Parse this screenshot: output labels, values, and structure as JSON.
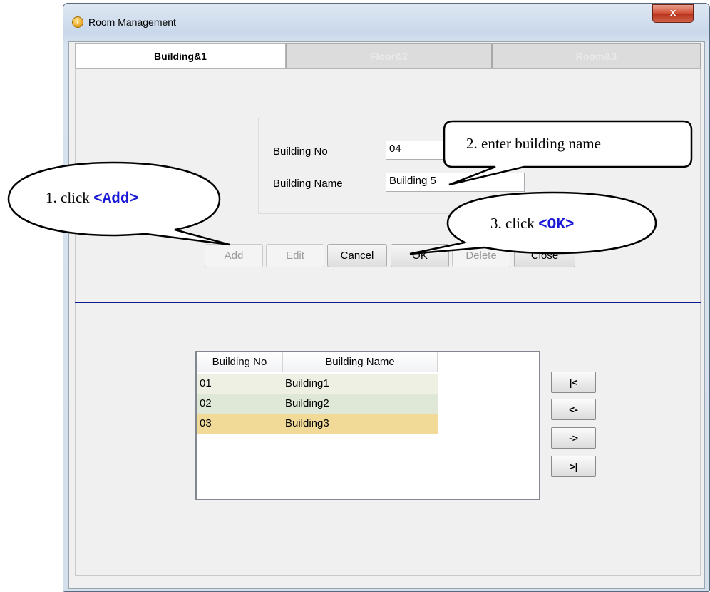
{
  "window": {
    "title": "Room Management",
    "close_glyph": "x",
    "icon": "info-icon"
  },
  "tabs": [
    {
      "label": "Building&1",
      "active": true
    },
    {
      "label": "Floor&2",
      "active": false
    },
    {
      "label": "Room&3",
      "active": false
    }
  ],
  "form": {
    "building_no_label": "Building No",
    "building_no_value": "04",
    "building_name_label": "Building Name",
    "building_name_value": "Building 5"
  },
  "buttons": [
    {
      "label": "Add",
      "enabled": false
    },
    {
      "label": "Edit",
      "enabled": false
    },
    {
      "label": "Cancel",
      "enabled": true
    },
    {
      "label": "OK",
      "enabled": true
    },
    {
      "label": "Delete",
      "enabled": false
    },
    {
      "label": "Close",
      "enabled": true
    }
  ],
  "list": {
    "columns": [
      "Building No",
      "Building Name"
    ],
    "rows": [
      {
        "no": "01",
        "name": "Building1",
        "color": "#eef0e4"
      },
      {
        "no": "02",
        "name": "Building2",
        "color": "#dfe8d6"
      },
      {
        "no": "03",
        "name": "Building3",
        "color": "#f1da98"
      }
    ]
  },
  "nav": {
    "first": "|<",
    "prev": "<-",
    "next": "->",
    "last": ">|"
  },
  "callouts": {
    "step1_prefix": "1. click ",
    "step1_key": "<Add>",
    "step2": "2. enter building name",
    "step3_prefix": "3. click ",
    "step3_key": "<OK>"
  },
  "colors": {
    "separator": "#0b1f8c",
    "callout_key": "#1a1ad6",
    "close_button": "#c8432d"
  }
}
